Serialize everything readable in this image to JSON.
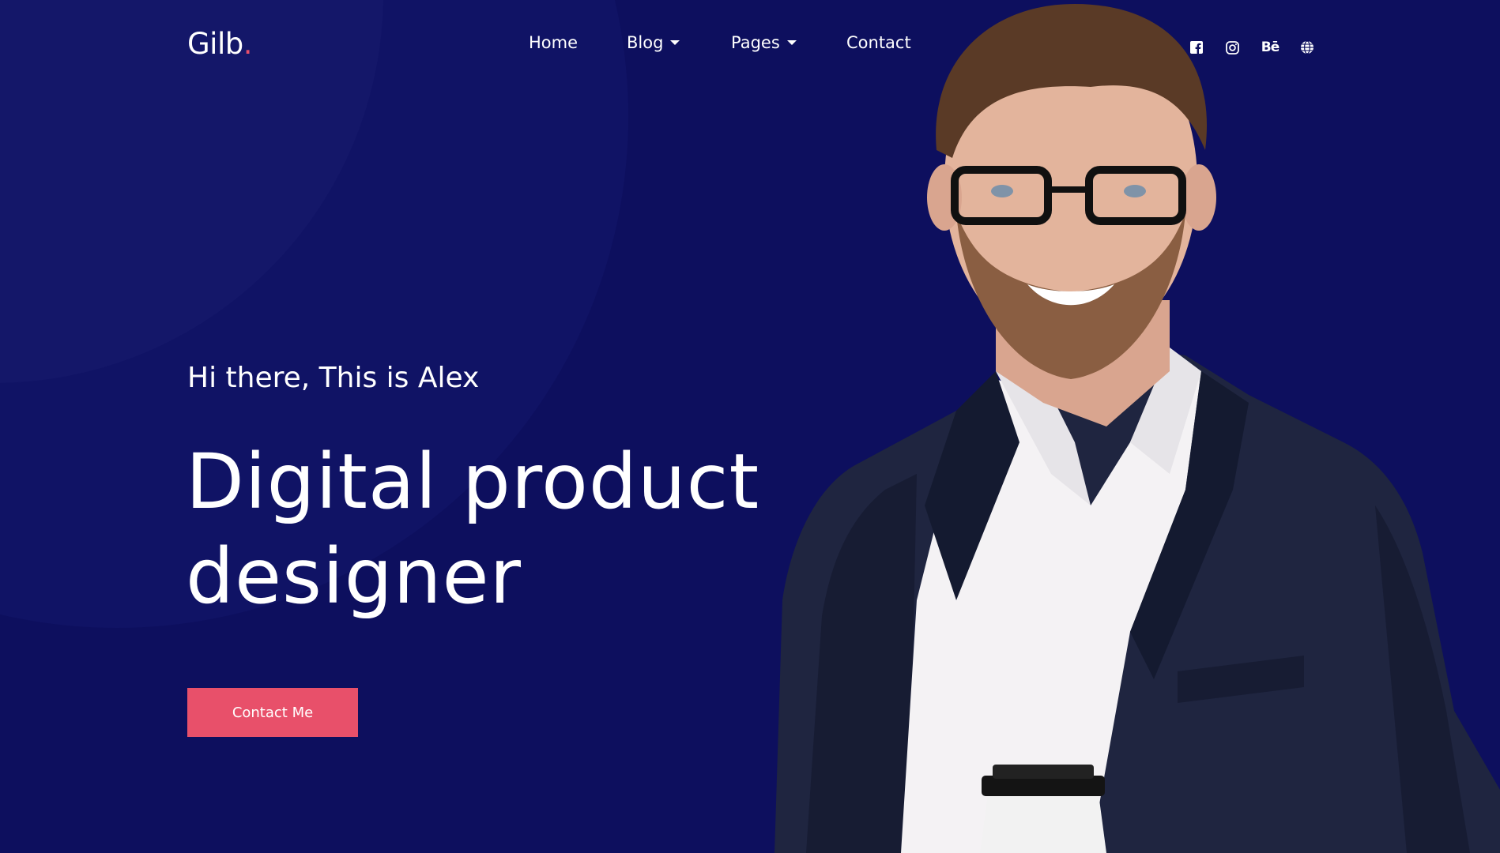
{
  "brand": {
    "name": "Gilb",
    "dot": ".",
    "accent_color": "#e8506a"
  },
  "nav": {
    "items": [
      {
        "label": "Home",
        "has_dropdown": false
      },
      {
        "label": "Blog",
        "has_dropdown": true
      },
      {
        "label": "Pages",
        "has_dropdown": true
      },
      {
        "label": "Contact",
        "has_dropdown": false
      }
    ]
  },
  "social": {
    "icons": [
      "facebook-icon",
      "instagram-icon",
      "behance-icon",
      "globe-icon"
    ],
    "behance_text": "Bē"
  },
  "hero": {
    "greeting": "Hi there, This is Alex",
    "headline_line1": "Digital product",
    "headline_line2": "designer",
    "cta_label": "Contact Me"
  },
  "colors": {
    "background": "#0d0f5e",
    "cta": "#e8506a",
    "text": "#ffffff"
  }
}
